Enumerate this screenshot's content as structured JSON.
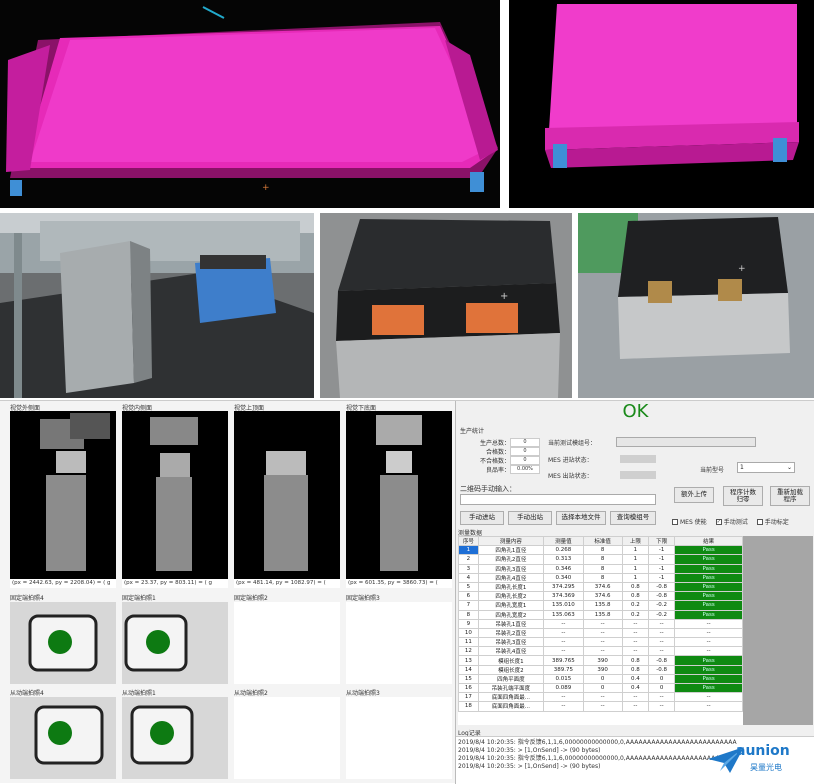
{
  "software": {
    "cam_titles": [
      "视觉外侧面",
      "视觉内侧面",
      "视觉上顶面",
      "视觉下底面"
    ],
    "cam_coords": [
      "(px = 2442.63,  py = 2208.04) = ( g",
      "(px = 23.37,  py = 803.11) = ( g",
      "(px = 481.14,  py = 1082.97) = (",
      "(px = 601.35,  py = 3860.73) = ("
    ],
    "fixed_titles": [
      "固定端拍照4",
      "固定端拍照1",
      "固定端拍照2",
      "固定端拍照3"
    ],
    "moving_titles": [
      "从动端拍照4",
      "从动端拍照1",
      "从动端拍照2",
      "从动端拍照3"
    ],
    "status": "OK",
    "stats_header": "生产统计",
    "stats": [
      {
        "label": "生产总数：",
        "value": "0"
      },
      {
        "label": "合格数：",
        "value": "0"
      },
      {
        "label": "不合格数：",
        "value": "0"
      },
      {
        "label": "良品率：",
        "value": "0.00%"
      }
    ],
    "mes_labels": [
      "当前测试模组号：",
      "MES 进站状态：",
      "MES 出站状态："
    ],
    "model_label": "当前型号",
    "model_value": "1",
    "qr_label": "二维码手动输入：",
    "buttons": {
      "upload": "额外上传",
      "reset": "程序计数\n归零",
      "reload": "重新加载\n程序",
      "manual_in": "手动进站",
      "manual_out": "手动出站",
      "select_file": "选择本地文件",
      "query": "查询模组号"
    },
    "checkboxes": [
      {
        "label": "MES 使能",
        "checked": false
      },
      {
        "label": "手动测试",
        "checked": true
      },
      {
        "label": "手动标定",
        "checked": false
      }
    ],
    "table_title": "测量数据",
    "table_headers": [
      "序号",
      "测量内容",
      "测量值",
      "标准值",
      "上限",
      "下限",
      "结果"
    ],
    "rows": [
      [
        "1",
        "四角孔1直径",
        "0.268",
        "8",
        "1",
        "-1",
        "Pass"
      ],
      [
        "2",
        "四角孔2直径",
        "0.313",
        "8",
        "1",
        "-1",
        "Pass"
      ],
      [
        "3",
        "四角孔3直径",
        "0.346",
        "8",
        "1",
        "-1",
        "Pass"
      ],
      [
        "4",
        "四角孔4直径",
        "0.340",
        "8",
        "1",
        "-1",
        "Pass"
      ],
      [
        "5",
        "四角孔长度1",
        "374.295",
        "374.6",
        "0.8",
        "-0.8",
        "Pass"
      ],
      [
        "6",
        "四角孔长度2",
        "374.369",
        "374.6",
        "0.8",
        "-0.8",
        "Pass"
      ],
      [
        "7",
        "四角孔宽度1",
        "135.010",
        "135.8",
        "0.2",
        "-0.2",
        "Pass"
      ],
      [
        "8",
        "四角孔宽度2",
        "135.063",
        "135.8",
        "0.2",
        "-0.2",
        "Pass"
      ],
      [
        "9",
        "吊装孔1直径",
        "--",
        "--",
        "--",
        "--",
        "--"
      ],
      [
        "10",
        "吊装孔2直径",
        "--",
        "--",
        "--",
        "--",
        "--"
      ],
      [
        "11",
        "吊装孔3直径",
        "--",
        "--",
        "--",
        "--",
        "--"
      ],
      [
        "12",
        "吊装孔4直径",
        "--",
        "--",
        "--",
        "--",
        "--"
      ],
      [
        "13",
        "模组长度1",
        "389.765",
        "390",
        "0.8",
        "-0.8",
        "Pass"
      ],
      [
        "14",
        "模组长度2",
        "389.75",
        "390",
        "0.8",
        "-0.8",
        "Pass"
      ],
      [
        "15",
        "四角平面度",
        "0.015",
        "0",
        "0.4",
        "0",
        "Pass"
      ],
      [
        "16",
        "吊装孔端平面度",
        "0.089",
        "0",
        "0.4",
        "0",
        "Pass"
      ],
      [
        "17",
        "底面四角面最...",
        "--",
        "--",
        "--",
        "--",
        "--"
      ],
      [
        "18",
        "底面四角面最...",
        "--",
        "--",
        "--",
        "--",
        "--"
      ]
    ],
    "log_title": "Log记录",
    "log_lines": [
      "2019/8/4 10:20:35:  指令反馈6,1,1,6,00000000000000,0,AAAAAAAAAAAAAAAAAAAAAAAAAA",
      "2019/8/4 10:20:35:  > [1,OnSend] -> (90 bytes)",
      "2019/8/4 10:20:35:  指令反馈6,1,1,6,00000000000000,0,AAAAAAAAAAAAAAAAAAAAAAAAAA",
      "2019/8/4 10:20:35:  > [1,OnSend] -> (90 bytes)"
    ]
  },
  "logo": {
    "name": "aunion",
    "sub": "昊量光电"
  }
}
